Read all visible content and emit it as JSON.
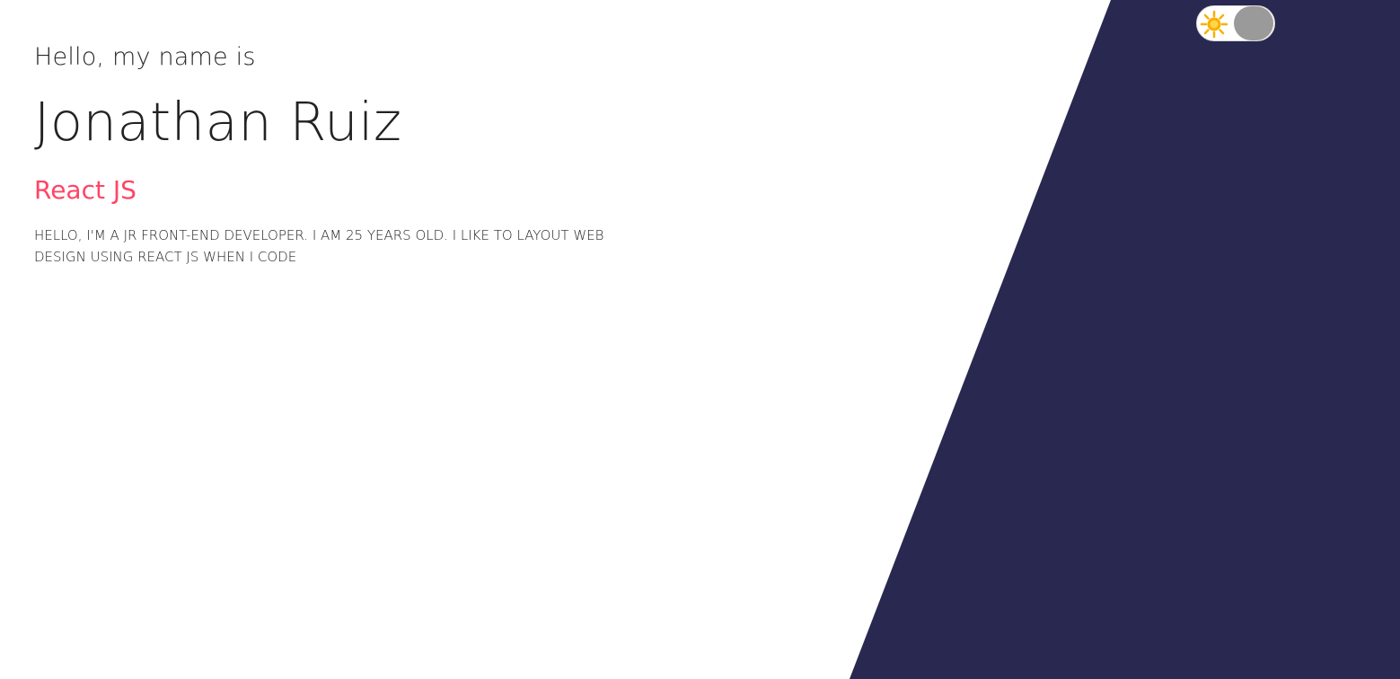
{
  "hero": {
    "greeting": "Hello, my name is",
    "name": "Jonathan Ruiz",
    "role": "React JS",
    "bio": "HELLO, I'M A JR FRONT-END DEVELOPER. I AM 25 YEARS OLD. I LIKE TO LAYOUT WEB DESIGN USING REACT JS WHEN I CODE"
  },
  "theme_toggle": {
    "icon": "sun-icon",
    "state": "light"
  },
  "colors": {
    "background": "#ffffff",
    "panel": "#282850",
    "accent": "#ff4566",
    "sun": "#f8b000",
    "knob": "#9a9a9a"
  }
}
